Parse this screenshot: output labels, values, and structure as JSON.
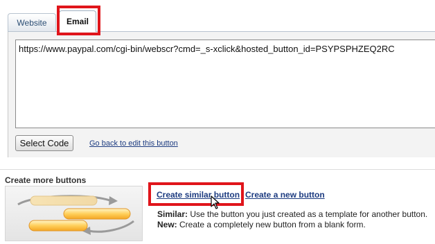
{
  "tabs": [
    {
      "label": "Website",
      "active": false
    },
    {
      "label": "Email",
      "active": true
    }
  ],
  "code": {
    "value": "https://www.paypal.com/cgi-bin/webscr?cmd=_s-xclick&hosted_button_id=PSYPSPHZEQ2RC"
  },
  "actions": {
    "select_code": "Select Code",
    "back_link": "Go back to edit this button"
  },
  "more": {
    "title": "Create more buttons",
    "create_similar": "Create similar button",
    "create_new": "Create a new button",
    "similar_label": "Similar:",
    "similar_text": " Use the button you just created as a template for another button.",
    "new_label": "New:",
    "new_text": " Create a completely new button from a blank form."
  },
  "colors": {
    "highlight": "#e0151b",
    "link": "#1c3b80"
  }
}
